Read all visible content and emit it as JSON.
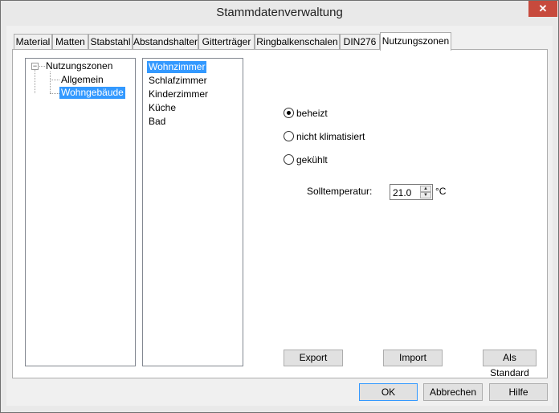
{
  "window": {
    "title": "Stammdatenverwaltung",
    "close_glyph": "✕"
  },
  "tabs": [
    "Material",
    "Matten",
    "Stabstahl",
    "Abstandshalter",
    "Gitterträger",
    "Ringbalkenschalen",
    "DIN276",
    "Nutzungszonen"
  ],
  "active_tab": "Nutzungszonen",
  "tree": {
    "expander_glyph": "−",
    "root": "Nutzungszonen",
    "children": [
      "Allgemein",
      "Wohngebäude"
    ],
    "selected": "Wohngebäude"
  },
  "rooms": {
    "items": [
      "Wohnzimmer",
      "Schlafzimmer",
      "Kinderzimmer",
      "Küche",
      "Bad"
    ],
    "selected": "Wohnzimmer"
  },
  "climate": {
    "options": [
      "beheizt",
      "nicht klimatisiert",
      "gekühlt"
    ],
    "selected": "beheizt"
  },
  "temperature": {
    "label": "Solltemperatur:",
    "value": "21.0",
    "unit": "°C"
  },
  "panel_buttons": {
    "export": "Export",
    "import": "Import",
    "standard": "Als Standard"
  },
  "footer_buttons": {
    "ok": "OK",
    "cancel": "Abbrechen",
    "help": "Hilfe"
  }
}
